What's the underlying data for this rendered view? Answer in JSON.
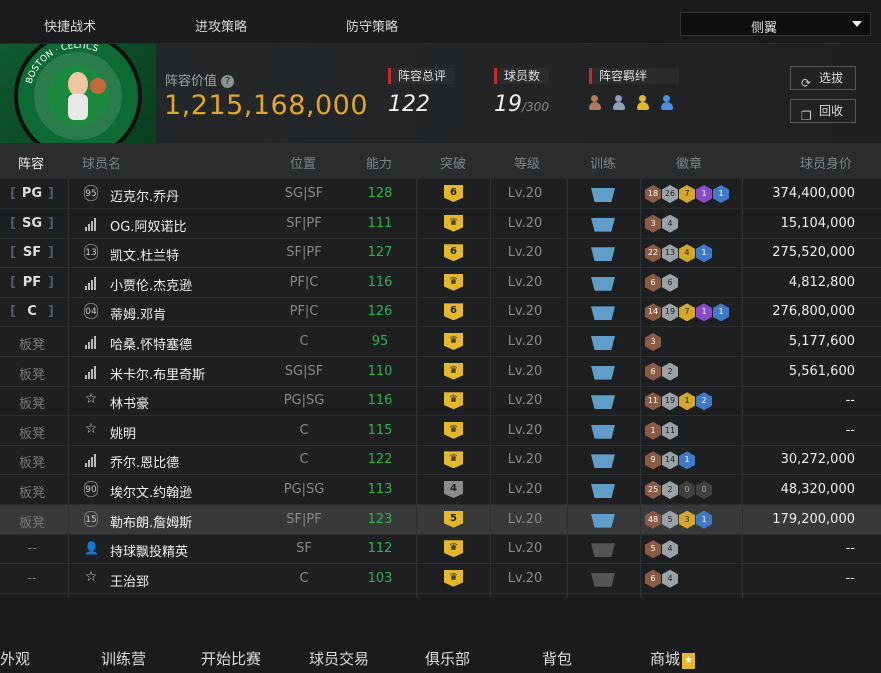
{
  "topnav": {
    "tabs": [
      "快捷战术",
      "进攻策略",
      "防守策略"
    ],
    "dropdown_value": "侧翼"
  },
  "team": {
    "logo_text": "BOSTON CELTICS",
    "value_label": "阵容价值",
    "value": "1,215,168,000",
    "rating_label": "阵容总评",
    "rating": "122",
    "count_label": "球员数",
    "count": "19",
    "count_max": "/300",
    "bond_label": "阵容羁绊",
    "bond_icons": [
      "bronze-bond-icon",
      "silver-bond-icon",
      "gold-bond-icon",
      "blue-bond-icon"
    ],
    "select_button": "选拔",
    "recycle_button": "回收"
  },
  "table": {
    "headers": [
      "阵容",
      "球员名",
      "位置",
      "能力",
      "突破",
      "等级",
      "训练",
      "徽章",
      "球员身价"
    ],
    "rows": [
      {
        "slot": "PG",
        "num": "95",
        "icon": "number",
        "name": "迈克尔.乔丹",
        "role": "SG|SF",
        "ovr": "128",
        "brk": "6",
        "brk_style": "gold",
        "lv": "Lv.20",
        "train": "on",
        "badges": [
          [
            "18",
            "bronze"
          ],
          [
            "26",
            "silver"
          ],
          [
            "7",
            "gold"
          ],
          [
            "1",
            "purple"
          ],
          [
            "1",
            "blue"
          ]
        ],
        "price": "374,400,000"
      },
      {
        "slot": "SG",
        "num": "",
        "icon": "bars",
        "name": "OG.阿奴诺比",
        "role": "SF|PF",
        "ovr": "111",
        "brk": "♛",
        "brk_style": "gold",
        "lv": "Lv.20",
        "train": "on",
        "badges": [
          [
            "3",
            "bronze"
          ],
          [
            "4",
            "silver"
          ]
        ],
        "price": "15,104,000"
      },
      {
        "slot": "SF",
        "num": "13",
        "icon": "number",
        "name": "凯文.杜兰特",
        "role": "SF|PF",
        "ovr": "127",
        "brk": "6",
        "brk_style": "gold",
        "lv": "Lv.20",
        "train": "on",
        "badges": [
          [
            "22",
            "bronze"
          ],
          [
            "13",
            "silver"
          ],
          [
            "4",
            "gold"
          ],
          [
            "1",
            "blue"
          ]
        ],
        "price": "275,520,000"
      },
      {
        "slot": "PF",
        "num": "",
        "icon": "bars",
        "name": "小贾伦.杰克逊",
        "role": "PF|C",
        "ovr": "116",
        "brk": "♛",
        "brk_style": "gold",
        "lv": "Lv.20",
        "train": "on",
        "badges": [
          [
            "6",
            "bronze"
          ],
          [
            "6",
            "silver"
          ]
        ],
        "price": "4,812,800"
      },
      {
        "slot": "C",
        "num": "04",
        "icon": "number",
        "name": "蒂姆.邓肯",
        "role": "PF|C",
        "ovr": "126",
        "brk": "6",
        "brk_style": "gold",
        "lv": "Lv.20",
        "train": "on",
        "badges": [
          [
            "14",
            "bronze"
          ],
          [
            "19",
            "silver"
          ],
          [
            "7",
            "gold"
          ],
          [
            "1",
            "purple"
          ],
          [
            "1",
            "blue"
          ]
        ],
        "price": "276,800,000"
      },
      {
        "slot": "板凳",
        "num": "",
        "icon": "bars",
        "name": "哈桑.怀特塞德",
        "role": "C",
        "ovr": "95",
        "brk": "♛",
        "brk_style": "gold",
        "lv": "Lv.20",
        "train": "on",
        "badges": [
          [
            "3",
            "bronze"
          ]
        ],
        "price": "5,177,600"
      },
      {
        "slot": "板凳",
        "num": "",
        "icon": "bars",
        "name": "米卡尔.布里奇斯",
        "role": "SG|SF",
        "ovr": "110",
        "brk": "♛",
        "brk_style": "gold",
        "lv": "Lv.20",
        "train": "on",
        "badges": [
          [
            "6",
            "bronze"
          ],
          [
            "2",
            "silver"
          ]
        ],
        "price": "5,561,600"
      },
      {
        "slot": "板凳",
        "num": "",
        "icon": "star",
        "name": "林书豪",
        "role": "PG|SG",
        "ovr": "116",
        "brk": "♛",
        "brk_style": "gold",
        "lv": "Lv.20",
        "train": "on",
        "badges": [
          [
            "11",
            "bronze"
          ],
          [
            "19",
            "silver"
          ],
          [
            "1",
            "gold"
          ],
          [
            "2",
            "blue"
          ]
        ],
        "price": "--"
      },
      {
        "slot": "板凳",
        "num": "",
        "icon": "star",
        "name": "姚明",
        "role": "C",
        "ovr": "115",
        "brk": "♛",
        "brk_style": "gold",
        "lv": "Lv.20",
        "train": "on",
        "badges": [
          [
            "1",
            "bronze"
          ],
          [
            "11",
            "silver"
          ]
        ],
        "price": "--"
      },
      {
        "slot": "板凳",
        "num": "",
        "icon": "bars",
        "name": "乔尔.恩比德",
        "role": "C",
        "ovr": "122",
        "brk": "♛",
        "brk_style": "gold",
        "lv": "Lv.20",
        "train": "on",
        "badges": [
          [
            "9",
            "bronze"
          ],
          [
            "14",
            "silver"
          ],
          [
            "1",
            "blue"
          ]
        ],
        "price": "30,272,000"
      },
      {
        "slot": "板凳",
        "num": "90",
        "icon": "number",
        "name": "埃尔文.约翰逊",
        "role": "PG|SG",
        "ovr": "113",
        "brk": "4",
        "brk_style": "grey",
        "lv": "Lv.20",
        "train": "on",
        "badges": [
          [
            "25",
            "bronze"
          ],
          [
            "2",
            "silver"
          ],
          [
            "0",
            "dark"
          ],
          [
            "0",
            "dark"
          ]
        ],
        "price": "48,320,000"
      },
      {
        "slot": "板凳",
        "num": "15",
        "icon": "number",
        "name": "勒布朗.詹姆斯",
        "role": "SF|PF",
        "ovr": "123",
        "brk": "5",
        "brk_style": "gold",
        "lv": "Lv.20",
        "train": "on",
        "badges": [
          [
            "48",
            "bronze"
          ],
          [
            "5",
            "silver"
          ],
          [
            "3",
            "gold"
          ],
          [
            "1",
            "blue"
          ]
        ],
        "price": "179,200,000"
      },
      {
        "slot": "--",
        "num": "",
        "icon": "person",
        "name": "持球飘投精英",
        "role": "SF",
        "ovr": "112",
        "brk": "♛",
        "brk_style": "gold",
        "lv": "Lv.20",
        "train": "off",
        "badges": [
          [
            "5",
            "bronze"
          ],
          [
            "4",
            "silver"
          ]
        ],
        "price": "--"
      },
      {
        "slot": "--",
        "num": "",
        "icon": "star",
        "name": "王治郅",
        "role": "C",
        "ovr": "103",
        "brk": "♛",
        "brk_style": "gold",
        "lv": "Lv.20",
        "train": "off",
        "badges": [
          [
            "6",
            "bronze"
          ],
          [
            "4",
            "silver"
          ]
        ],
        "price": "--"
      }
    ],
    "selected_row": 11
  },
  "bottom_nav": [
    "外观",
    "训练营",
    "开始比赛",
    "球员交易",
    "俱乐部",
    "背包",
    "商城"
  ],
  "colors": {
    "gold": "#e0a82a",
    "green": "#2fb24a",
    "red_accent": "#d02828",
    "train_blue": "#5f9ec8"
  }
}
